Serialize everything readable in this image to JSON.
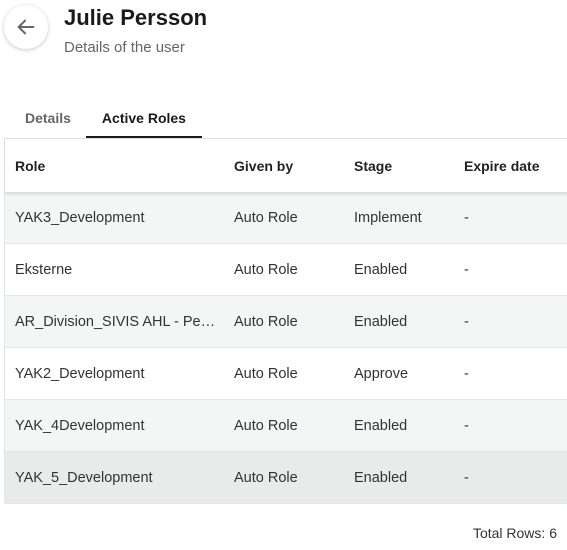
{
  "header": {
    "title": "Julie Persson",
    "subtitle": "Details of the user",
    "back_icon": "arrow-left-icon"
  },
  "tabs": [
    {
      "label": "Details",
      "active": false
    },
    {
      "label": "Active Roles",
      "active": true
    }
  ],
  "table": {
    "columns": [
      "Role",
      "Given by",
      "Stage",
      "Expire date"
    ],
    "rows": [
      {
        "role": "YAK3_Development",
        "given_by": "Auto Role",
        "stage": "Implement",
        "expire": "-"
      },
      {
        "role": "Eksterne",
        "given_by": "Auto Role",
        "stage": "Enabled",
        "expire": "-"
      },
      {
        "role": "AR_Division_SIVIS AHL - Per…",
        "given_by": "Auto Role",
        "stage": "Enabled",
        "expire": "-"
      },
      {
        "role": "YAK2_Development",
        "given_by": "Auto Role",
        "stage": "Approve",
        "expire": "-"
      },
      {
        "role": "YAK_4Development",
        "given_by": "Auto Role",
        "stage": "Enabled",
        "expire": "-"
      },
      {
        "role": "YAK_5_Development",
        "given_by": "Auto Role",
        "stage": "Enabled",
        "expire": "-"
      }
    ]
  },
  "footer": {
    "total_rows": "Total Rows: 6"
  },
  "colors": {
    "row_shaded": "#f4f6f6",
    "row_hover": "#e9ebeb",
    "active_tab_underline": "#1a1a1a"
  }
}
